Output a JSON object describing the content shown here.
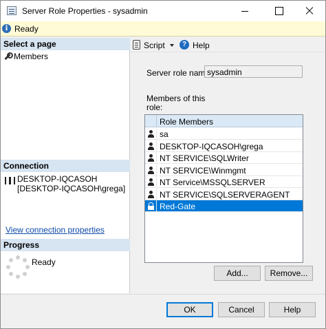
{
  "window": {
    "title": "Server Role Properties - sysadmin"
  },
  "status": {
    "text": "Ready"
  },
  "left": {
    "select_page_header": "Select a page",
    "pages": [
      {
        "label": "Members"
      }
    ],
    "connection_header": "Connection",
    "connection_server": "DESKTOP-IQCASOH",
    "connection_user": "[DESKTOP-IQCASOH\\grega]",
    "view_connection_link": "View connection properties",
    "progress_header": "Progress",
    "progress_status": "Ready"
  },
  "toolbar": {
    "script_label": "Script",
    "help_label": "Help"
  },
  "form": {
    "role_name_label": "Server role name:",
    "role_name_value": "sysadmin",
    "members_label_line1": "Members of this",
    "members_label_line2": "role:"
  },
  "grid": {
    "header": "Role Members",
    "rows": [
      {
        "name": "sa",
        "icon": "user-icon"
      },
      {
        "name": "DESKTOP-IQCASOH\\grega",
        "icon": "user-icon"
      },
      {
        "name": "NT SERVICE\\SQLWriter",
        "icon": "user-icon"
      },
      {
        "name": "NT SERVICE\\Winmgmt",
        "icon": "user-icon"
      },
      {
        "name": "NT Service\\MSSQLSERVER",
        "icon": "user-icon"
      },
      {
        "name": "NT SERVICE\\SQLSERVERAGENT",
        "icon": "user-icon"
      },
      {
        "name": "Red-Gate",
        "icon": "lock-icon",
        "selected": true
      }
    ]
  },
  "buttons": {
    "add": "Add...",
    "remove": "Remove...",
    "ok": "OK",
    "cancel": "Cancel",
    "help": "Help"
  },
  "colors": {
    "selection": "#0078d7",
    "section_header": "#d7e4f1",
    "status_bar": "#fffbd6",
    "link": "#0f4aa8"
  }
}
